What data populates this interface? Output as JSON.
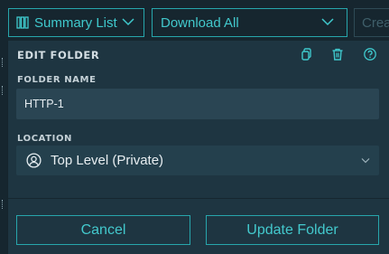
{
  "toolbar": {
    "view_label": "Summary List",
    "download_label": "Download All",
    "create_label": "Crea"
  },
  "dialog": {
    "title": "EDIT FOLDER",
    "icons": [
      "copy-icon",
      "trash-icon",
      "help-icon"
    ],
    "folder_name_label": "FOLDER NAME",
    "folder_name_value": "HTTP-1",
    "location_label": "LOCATION",
    "location_value": "Top Level (Private)",
    "cancel_label": "Cancel",
    "update_label": "Update Folder"
  },
  "colors": {
    "accent": "#3fc9cd",
    "background": "#1b2d37",
    "panel": "#1e3541",
    "input": "#2a4553"
  }
}
